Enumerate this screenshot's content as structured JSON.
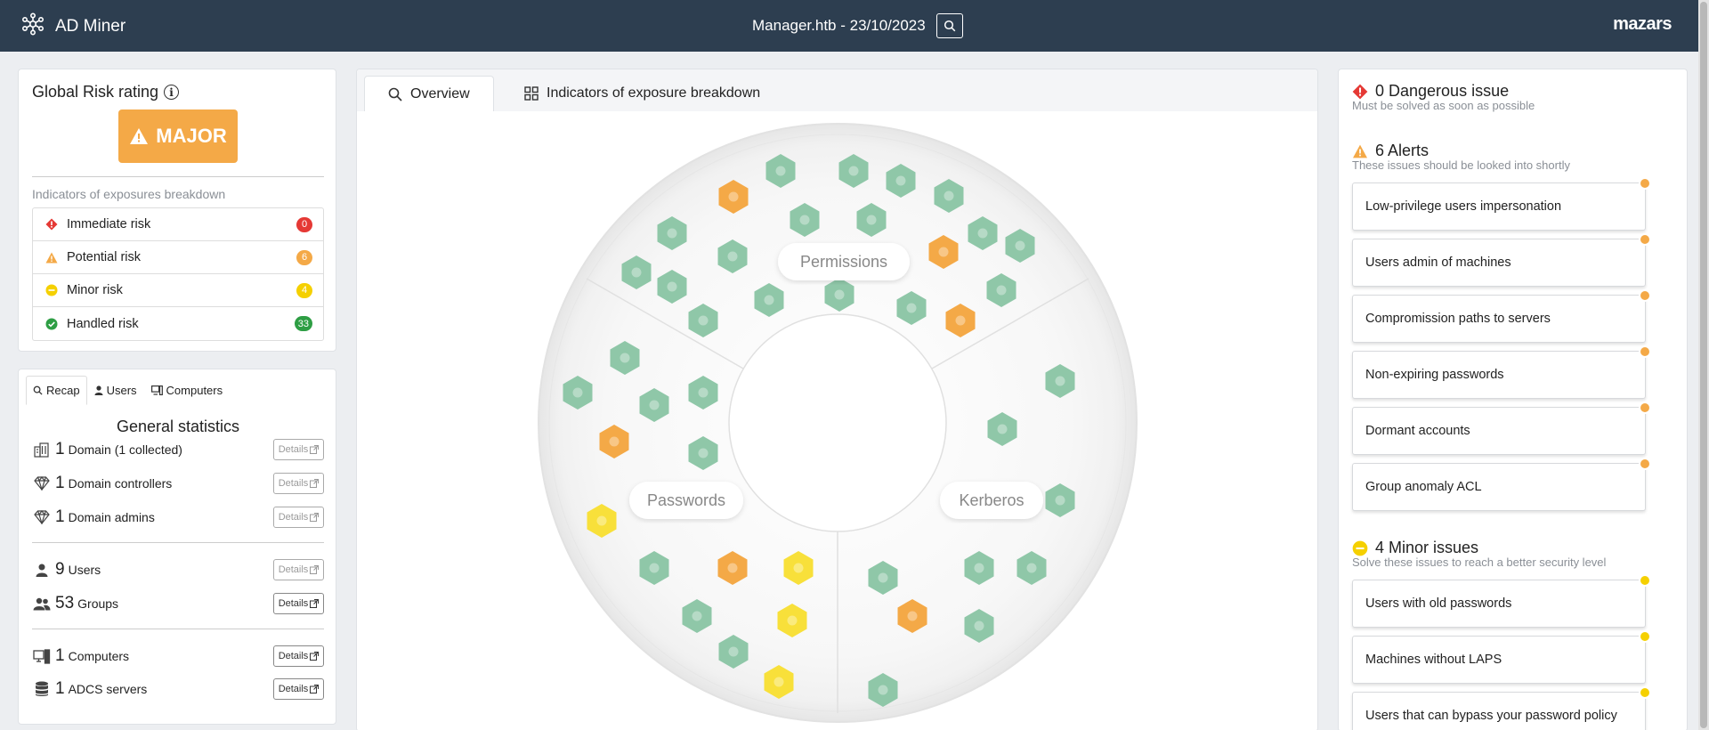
{
  "header": {
    "app_name": "AD Miner",
    "title": "Manager.htb - 23/10/2023",
    "company": "mazars"
  },
  "global_risk": {
    "title": "Global Risk rating",
    "rating": "MAJOR",
    "subtitle": "Indicators of exposures breakdown",
    "rows": [
      {
        "label": "Immediate risk",
        "count": "0",
        "color": "#e53935"
      },
      {
        "label": "Potential risk",
        "count": "6",
        "color": "#f4a947"
      },
      {
        "label": "Minor risk",
        "count": "4",
        "color": "#f5d000"
      },
      {
        "label": "Handled risk",
        "count": "33",
        "color": "#2e9e44"
      }
    ]
  },
  "stats": {
    "tabs": [
      "Recap",
      "Users",
      "Computers"
    ],
    "title": "General statistics",
    "details_label": "Details",
    "rows": [
      {
        "num": "1",
        "label": "Domain (1 collected)",
        "icon": "building-icon"
      },
      {
        "num": "1",
        "label": "Domain controllers",
        "icon": "diamond-icon"
      },
      {
        "num": "1",
        "label": "Domain admins",
        "icon": "diamond-icon"
      },
      {
        "num": "9",
        "label": "Users",
        "icon": "user-icon"
      },
      {
        "num": "53",
        "label": "Groups",
        "icon": "users-icon"
      },
      {
        "num": "1",
        "label": "Computers",
        "icon": "computer-icon"
      },
      {
        "num": "1",
        "label": "ADCS servers",
        "icon": "database-icon"
      }
    ]
  },
  "main": {
    "tabs": [
      "Overview",
      "Indicators of exposure breakdown"
    ],
    "wheel_sections": [
      "Permissions",
      "Passwords",
      "Kerberos"
    ]
  },
  "issues": {
    "dangerous": {
      "title": "0 Dangerous issue",
      "subtitle": "Must be solved as soon as possible"
    },
    "alerts": {
      "title": "6 Alerts",
      "subtitle": "These issues should be looked into shortly",
      "items": [
        "Low-privilege users impersonation",
        "Users admin of machines",
        "Compromission paths to servers",
        "Non-expiring passwords",
        "Dormant accounts",
        "Group anomaly ACL"
      ]
    },
    "minor": {
      "title": "4 Minor issues",
      "subtitle": "Solve these issues to reach a better security level",
      "items": [
        "Users with old passwords",
        "Machines without LAPS",
        "Users that can bypass your password policy"
      ]
    }
  },
  "colors": {
    "header_bg": "#2d3e50",
    "major": "#f4a947",
    "handled": "#8fc7a8",
    "alert": "#f4a947",
    "minor": "#f8e03a"
  }
}
